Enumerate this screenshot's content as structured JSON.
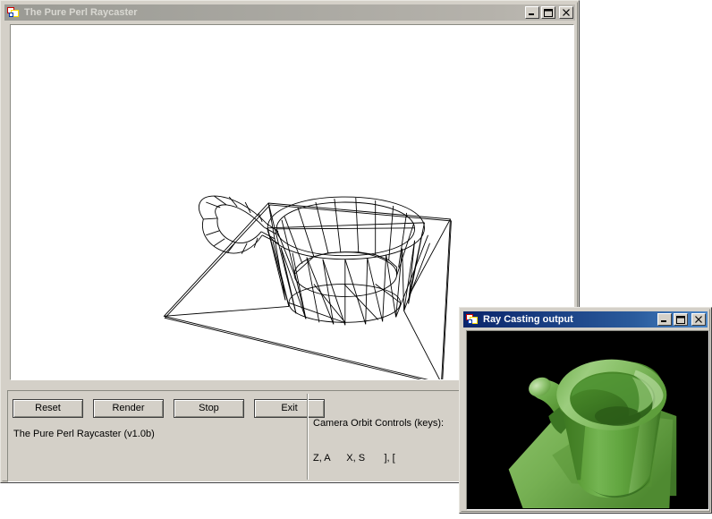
{
  "main_window": {
    "title": "The Pure Perl Raycaster",
    "active": false,
    "icon": "perl-tk-app-icon",
    "titlebar_buttons": [
      {
        "name": "minimize-button",
        "label": "Minimize",
        "glyph": "minimize-icon"
      },
      {
        "name": "maximize-button",
        "label": "Maximize",
        "glyph": "maximize-icon"
      },
      {
        "name": "close-button",
        "label": "Close",
        "glyph": "close-icon"
      }
    ],
    "buttons": [
      {
        "name": "reset-button",
        "label": "Reset"
      },
      {
        "name": "render-button",
        "label": "Render"
      },
      {
        "name": "stop-button",
        "label": "Stop"
      },
      {
        "name": "exit-button",
        "label": "Exit"
      }
    ],
    "status": "The Pure Perl Raycaster (v1.0b)",
    "help": {
      "heading": "Camera Orbit Controls (keys):",
      "keys": "Z, A      X, S       ], ["
    },
    "viewport": {
      "name": "wireframe-preview-canvas",
      "background": "#ffffff",
      "stroke": "#000000",
      "description": "Wireframe mesh of a mug with handle resting on a ground quad"
    }
  },
  "output_window": {
    "title": "Ray Casting output",
    "active": true,
    "icon": "perl-tk-app-icon",
    "titlebar_buttons": [
      {
        "name": "minimize-button",
        "label": "Minimize",
        "glyph": "minimize-icon"
      },
      {
        "name": "maximize-button",
        "label": "Maximize",
        "glyph": "maximize-icon"
      },
      {
        "name": "close-button",
        "label": "Close",
        "glyph": "close-icon"
      }
    ],
    "viewport": {
      "name": "raycast-output-canvas",
      "background": "#000000",
      "description": "Ray-cast shaded render of a green mug on a green plane"
    }
  },
  "colors": {
    "window_face": "#d4d0c8",
    "title_active_start": "#0a246a",
    "title_active_end": "#4a86c8",
    "title_inactive_start": "#9a9a94",
    "title_inactive_end": "#bdbab3",
    "render_black": "#000000",
    "render_green_light": "#8fc46a",
    "render_green_mid": "#5ea03a",
    "render_green_dark": "#3c7a26",
    "render_green_deep": "#2d5c1c"
  }
}
